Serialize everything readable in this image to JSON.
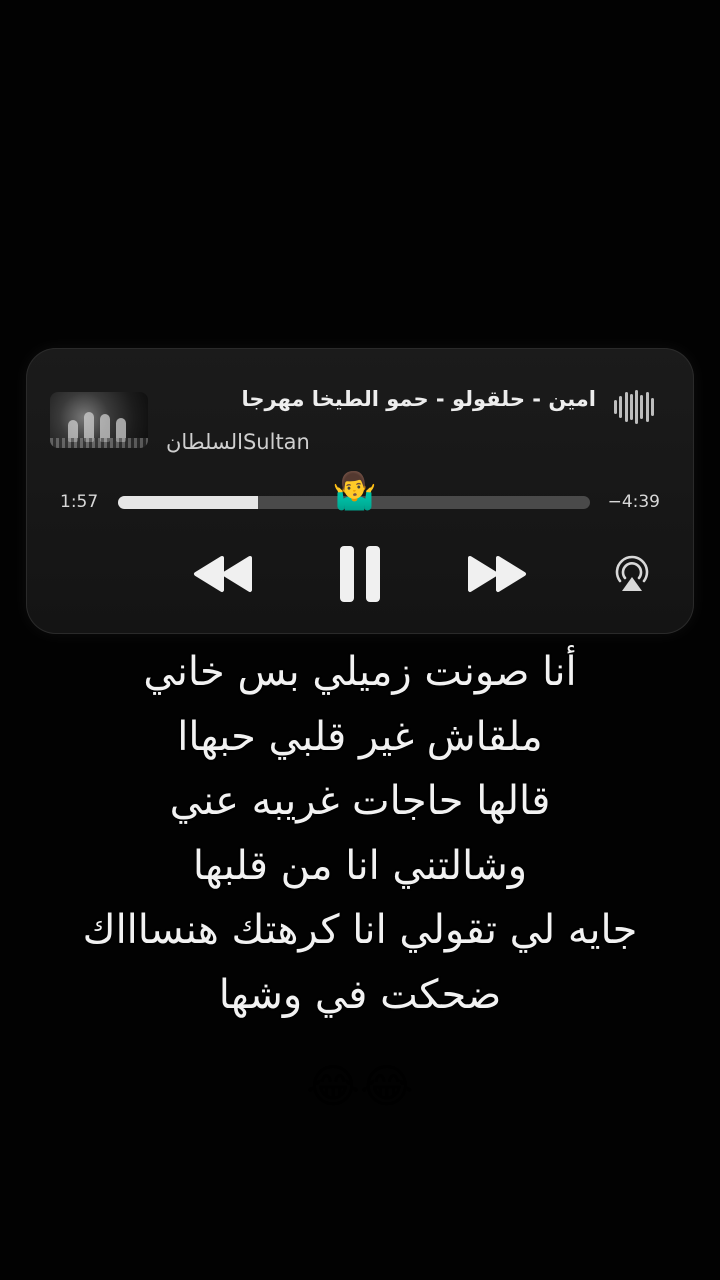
{
  "player": {
    "song_title": "امين - حلقولو - حمو الطيخا      مهرجا",
    "artist": "السلطانSultan",
    "time_elapsed": "1:57",
    "time_remaining": "−4:39",
    "progress_fraction": 0.297,
    "scrubber_emoji": "🤷‍♂️",
    "artwork_icon": "album-artwork",
    "wave_icon": "audio-waveform-icon",
    "rewind_icon": "rewind-icon",
    "pause_icon": "pause-icon",
    "forward_icon": "fast-forward-icon",
    "airplay_icon": "airplay-icon"
  },
  "lyrics": [
    "أنا صونت زميلي بس خاني",
    "ملقاش غير قلبي حبهاا",
    "قالها حاجات غريبه عني",
    "وشالتني انا من قلبها",
    "جايه لي تقولي انا كرهتك هنساااك",
    "ضحكت في وشها"
  ],
  "emoji_line": "😂😂",
  "colors": {
    "background": "#020202",
    "card": "#1b1b1b",
    "text": "#f2f2f2",
    "track": "#4a4a4a",
    "fill": "#e6e6e6"
  }
}
